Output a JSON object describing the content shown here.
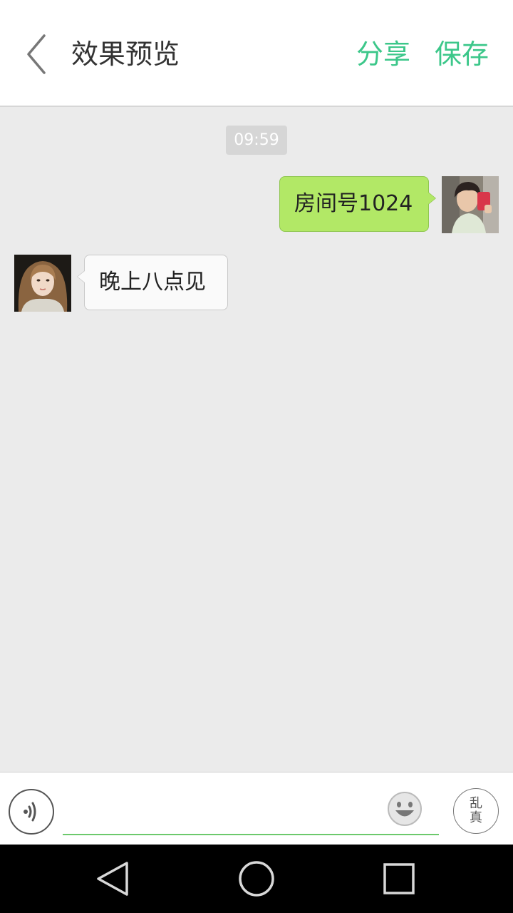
{
  "header": {
    "title": "效果预览",
    "share_label": "分享",
    "save_label": "保存",
    "back_icon": "chevron-left-icon",
    "accent_color": "#3cc78a"
  },
  "chat": {
    "timestamp": "09:59",
    "messages": [
      {
        "direction": "sent",
        "text": "房间号1024",
        "bubble_color": "#b2e866"
      },
      {
        "direction": "received",
        "text": "晚上八点见",
        "bubble_color": "#fafafa"
      }
    ]
  },
  "input_bar": {
    "voice_icon": "voice-icon",
    "input_value": "",
    "emoji_icon": "emoji-smile-icon",
    "seal_text": [
      "乱",
      "真"
    ]
  },
  "system_nav": {
    "icons": [
      "back-triangle-icon",
      "home-circle-icon",
      "recent-apps-square-icon"
    ]
  },
  "colors": {
    "background": "#ebebeb",
    "input_underline": "#6cc96c"
  }
}
